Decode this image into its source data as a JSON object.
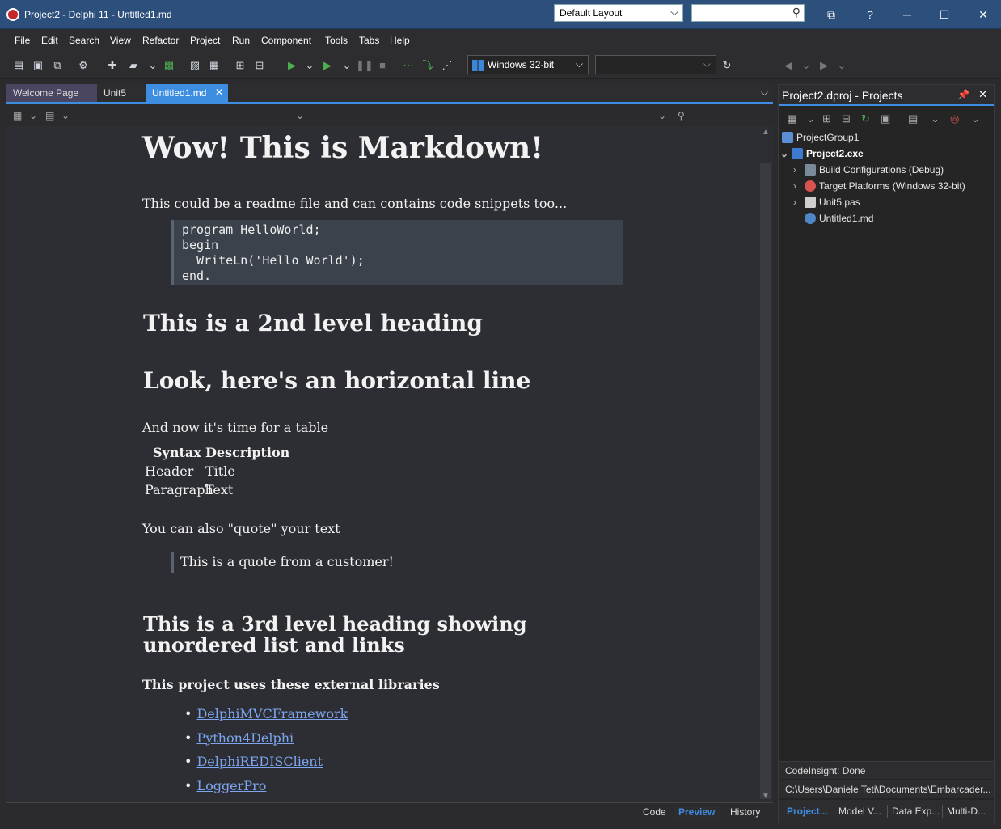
{
  "window": {
    "title": "Project2 - Delphi 11 - Untitled1.md",
    "layout_select": "Default Layout",
    "search_value": "",
    "help_label": "?"
  },
  "menu": [
    "File",
    "Edit",
    "Search",
    "View",
    "Refactor",
    "Project",
    "Run",
    "Component",
    "Tools",
    "Tabs",
    "Help"
  ],
  "toolbar": {
    "platform": "Windows 32-bit",
    "configuration": ""
  },
  "editor": {
    "tabs": [
      {
        "label": "Welcome Page"
      },
      {
        "label": "Unit5"
      },
      {
        "label": "Untitled1.md",
        "active": true
      }
    ],
    "footer_tabs": [
      "Code",
      "Preview",
      "History"
    ],
    "active_footer_tab": "Preview"
  },
  "markdown": {
    "h1": "Wow! This is Markdown!",
    "intro": "This could be a readme file and can contains code snippets too...",
    "code": "program HelloWorld;\nbegin\n  WriteLn('Hello World');\nend.",
    "h2_a": "This is a 2nd level heading",
    "h2_b": "Look, here's an horizontal line",
    "table_intro": "And now it's time for a table",
    "table": {
      "headers": [
        "Syntax",
        "Description"
      ],
      "rows": [
        [
          "Header",
          "Title"
        ],
        [
          "Paragraph",
          "Text"
        ]
      ]
    },
    "quote_intro": "You can also \"quote\" your text",
    "quote": "This is a quote from a customer!",
    "h3": "This is a 3rd level heading showing unordered list and links",
    "libs_title": "This project uses these external libraries",
    "links": [
      "DelphiMVCFramework",
      "Python4Delphi",
      "DelphiREDISClient",
      "LoggerPro"
    ]
  },
  "project_pane": {
    "title": "Project2.dproj - Projects",
    "tree": [
      {
        "label": "ProjectGroup1",
        "level": 0,
        "expander": "",
        "bold": false,
        "icon_color": "#5a8fd6"
      },
      {
        "label": "Project2.exe",
        "level": 0,
        "expander": "v",
        "bold": true,
        "icon_color": "#3d7bd0"
      },
      {
        "label": "Build Configurations (Debug)",
        "level": 1,
        "expander": ">",
        "bold": false,
        "icon_color": "#7a8a9a"
      },
      {
        "label": "Target Platforms (Windows 32-bit)",
        "level": 1,
        "expander": ">",
        "bold": false,
        "icon_color": "#d9534f"
      },
      {
        "label": "Unit5.pas",
        "level": 1,
        "expander": ">",
        "bold": false,
        "icon_color": "#cfcfcf"
      },
      {
        "label": "Untitled1.md",
        "level": 1,
        "expander": "",
        "bold": false,
        "icon_color": "#4f86c6"
      }
    ],
    "status_insight": "CodeInsight: Done",
    "status_path": "C:\\Users\\Daniele Teti\\Documents\\Embarcader...",
    "bottom_tabs": [
      "Project...",
      "Model V...",
      "Data Exp...",
      "Multi-D..."
    ]
  },
  "colors": {
    "accent": "#3d8ee0",
    "title_bar": "#2c4f7c",
    "link": "#7ea6f0",
    "preview_bg": "#2d2e33"
  }
}
